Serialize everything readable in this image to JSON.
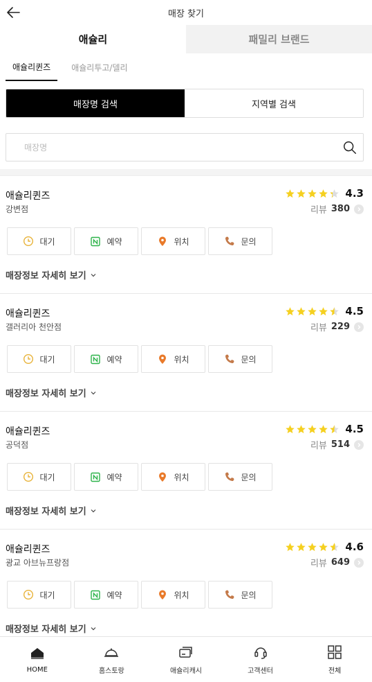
{
  "header": {
    "title": "매장 찾기"
  },
  "brand_tabs": [
    {
      "label": "애슐리",
      "active": true
    },
    {
      "label": "패밀리 브랜드",
      "active": false
    }
  ],
  "sub_tabs": [
    {
      "label": "애슐리퀸즈",
      "active": true
    },
    {
      "label": "애슐리투고/델리",
      "active": false
    }
  ],
  "search_modes": [
    {
      "label": "매장명 검색",
      "active": true
    },
    {
      "label": "지역별 검색",
      "active": false
    }
  ],
  "search": {
    "placeholder": "매장명",
    "value": ""
  },
  "action_labels": {
    "wait": "대기",
    "reserve": "예약",
    "location": "위치",
    "inquiry": "문의"
  },
  "detail_label": "매장정보 자세히 보기",
  "review_label": "리뷰",
  "stores": [
    {
      "name": "애슐리퀸즈",
      "branch": "강변점",
      "rating": "4.3",
      "rating_value": 4.3,
      "reviews": "380"
    },
    {
      "name": "애슐리퀸즈",
      "branch": "갤러리아 천안점",
      "rating": "4.5",
      "rating_value": 4.5,
      "reviews": "229"
    },
    {
      "name": "애슐리퀸즈",
      "branch": "공덕점",
      "rating": "4.5",
      "rating_value": 4.5,
      "reviews": "514"
    },
    {
      "name": "애슐리퀸즈",
      "branch": "광교 아브뉴프랑점",
      "rating": "4.6",
      "rating_value": 4.6,
      "reviews": "649"
    }
  ],
  "bottom_nav": [
    {
      "label": "HOME",
      "icon": "home-icon",
      "active": true
    },
    {
      "label": "홈스토랑",
      "icon": "cloche-icon",
      "active": false
    },
    {
      "label": "애슐리캐시",
      "icon": "cards-icon",
      "active": false
    },
    {
      "label": "고객센터",
      "icon": "headset-icon",
      "active": false
    },
    {
      "label": "전체",
      "icon": "grid-icon",
      "active": false
    }
  ],
  "colors": {
    "star": "#f5d020",
    "accent_black": "#000000",
    "wait_icon": "#e8b33a",
    "reserve_icon": "#2db34a",
    "location_icon": "#e97a2a",
    "phone_icon": "#c47a4a"
  }
}
